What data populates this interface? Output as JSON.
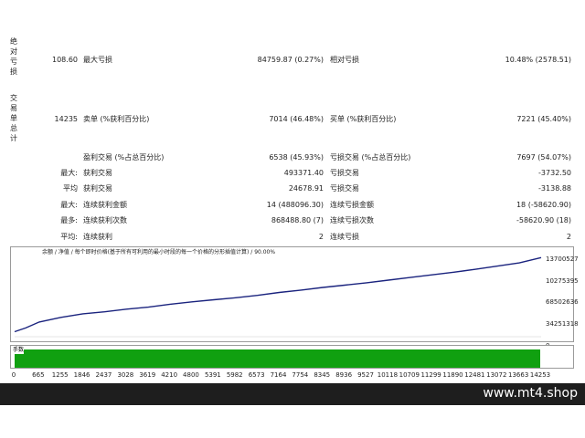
{
  "stats": {
    "abs_drawdown": {
      "label_chars": [
        "绝",
        "对",
        "亏",
        "损"
      ],
      "value": "108.60"
    },
    "max_drawdown": {
      "label": "最大亏损",
      "value": "84759.87 (0.27%)"
    },
    "rel_drawdown": {
      "label": "相对亏损",
      "value": "10.48% (2578.51)"
    },
    "total_trades": {
      "label_chars": [
        "交",
        "易",
        "单",
        "总",
        "计"
      ],
      "value": "14235"
    },
    "short_trades": {
      "label": "卖单 (%获利百分比)",
      "value": "7014 (46.48%)"
    },
    "long_trades": {
      "label": "买单 (%获利百分比)",
      "value": "7221 (45.40%)"
    },
    "profit_trades": {
      "label": "盈利交易 (%占总百分比)",
      "value": "6538 (45.93%)"
    },
    "loss_trades": {
      "label": "亏损交易 (%占总百分比)",
      "value": "7697 (54.07%)"
    },
    "rows": [
      {
        "prefix": "最大:",
        "l_label": "获利交易",
        "l_value": "493371.40",
        "r_label": "亏损交易",
        "r_value": "-3732.50"
      },
      {
        "prefix": "平均",
        "l_label": "获利交易",
        "l_value": "24678.91",
        "r_label": "亏损交易",
        "r_value": "-3138.88"
      },
      {
        "prefix": "最大:",
        "l_label": "连续获利金额",
        "l_value": "14 (488096.30)",
        "r_label": "连续亏损金额",
        "r_value": "18 (-58620.90)"
      },
      {
        "prefix": "最多:",
        "l_label": "连续获利次数",
        "l_value": "868488.80 (7)",
        "r_label": "连续亏损次数",
        "r_value": "-58620.90 (18)"
      },
      {
        "prefix": "平均:",
        "l_label": "连续获利",
        "l_value": "2",
        "r_label": "连续亏损",
        "r_value": "2"
      }
    ]
  },
  "chart_data": {
    "type": "line",
    "legend_text": "余额 / 净值 / 每个即时价格(基于所有可利用的最小时段的每一个价格的分形插值计算) / 90.00%",
    "legend": {
      "balance": "余额",
      "equity": "净值"
    },
    "x_ticks": [
      0,
      665,
      1255,
      1846,
      2437,
      3028,
      3619,
      4210,
      4800,
      5391,
      5982,
      6573,
      7164,
      7754,
      8345,
      8936,
      9527,
      10118,
      10709,
      11299,
      11890,
      12481,
      13072,
      13663,
      14253
    ],
    "y_ticks": [
      "13700527",
      "10275395",
      "68502636",
      "34251318",
      "0"
    ],
    "y_range": [
      0,
      13700527
    ],
    "x_range": [
      0,
      14253
    ],
    "series": [
      {
        "color": "#1a237e",
        "points": [
          [
            0,
            850000
          ],
          [
            300,
            1500000
          ],
          [
            665,
            2500000
          ],
          [
            1255,
            3300000
          ],
          [
            1846,
            3900000
          ],
          [
            2437,
            4250000
          ],
          [
            3028,
            4700000
          ],
          [
            3619,
            5050000
          ],
          [
            4210,
            5550000
          ],
          [
            4800,
            5950000
          ],
          [
            5391,
            6300000
          ],
          [
            5982,
            6650000
          ],
          [
            6573,
            7050000
          ],
          [
            7164,
            7550000
          ],
          [
            7754,
            7950000
          ],
          [
            8345,
            8400000
          ],
          [
            8936,
            8800000
          ],
          [
            9527,
            9200000
          ],
          [
            10118,
            9650000
          ],
          [
            10709,
            10100000
          ],
          [
            11299,
            10550000
          ],
          [
            11890,
            11000000
          ],
          [
            12481,
            11500000
          ],
          [
            13072,
            12050000
          ],
          [
            13663,
            12600000
          ],
          [
            14253,
            13500000
          ]
        ]
      }
    ],
    "volume_label": "手数",
    "volume_color": "#10a010"
  },
  "footer": {
    "brand": "www.mt4.shop"
  }
}
